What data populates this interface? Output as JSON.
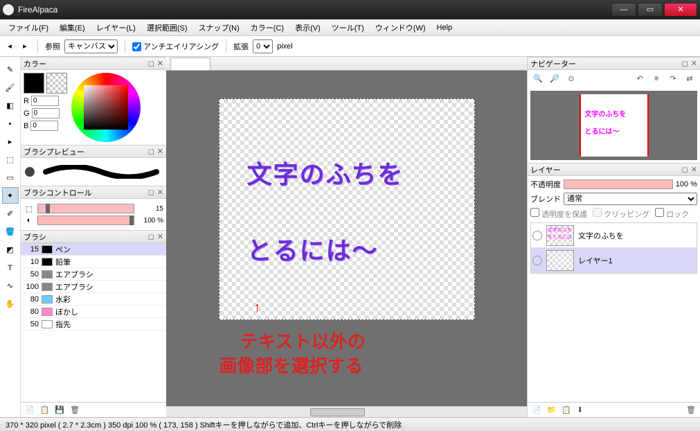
{
  "window": {
    "title": "FireAlpaca"
  },
  "menu": [
    "ファイル(F)",
    "編集(E)",
    "レイヤー(L)",
    "選択範囲(S)",
    "スナップ(N)",
    "カラー(C)",
    "表示(V)",
    "ツール(T)",
    "ウィンドウ(W)",
    "Help"
  ],
  "toolbar": {
    "ref_label": "参照",
    "ref_value": "キャンバス",
    "antialias": "アンチエイリアシング",
    "antialias_checked": true,
    "expand_label": "拡張",
    "expand_value": "0",
    "expand_unit": "pixel"
  },
  "left_tools": [
    "pen",
    "brush",
    "eraser",
    "dot",
    "move",
    "select",
    "rect-select",
    "wand",
    "eyedrop",
    "bucket",
    "gradient",
    "text",
    "lasso",
    "hand"
  ],
  "color": {
    "title": "カラー",
    "r_label": "R",
    "r_value": "0",
    "g_label": "G",
    "g_value": "0",
    "b_label": "B",
    "b_value": "0"
  },
  "brush_preview": {
    "title": "ブラシプレビュー"
  },
  "brush_control": {
    "title": "ブラシコントロール",
    "size_value": "15",
    "opacity_value": "100 %"
  },
  "brush_list": {
    "title": "ブラシ",
    "items": [
      {
        "size": "15",
        "name": "ペン",
        "color": "#000",
        "sel": true
      },
      {
        "size": "10",
        "name": "鉛筆",
        "color": "#000"
      },
      {
        "size": "50",
        "name": "エアブラシ",
        "color": "#888"
      },
      {
        "size": "100",
        "name": "エアブラシ",
        "color": "#888"
      },
      {
        "size": "80",
        "name": "水彩",
        "color": "#6cf"
      },
      {
        "size": "80",
        "name": "ぼかし",
        "color": "#f8c"
      },
      {
        "size": "50",
        "name": "指先",
        "color": "#fff"
      }
    ]
  },
  "tab_title": "",
  "canvas": {
    "line1": "文字のふちを",
    "line2": "とるには〜",
    "arrow": "↑",
    "note1": "テキスト以外の",
    "note2": "画像部を選択する"
  },
  "navigator": {
    "title": "ナビゲーター",
    "mini_line1": "文字のふちを",
    "mini_line2": "とるには〜"
  },
  "layers": {
    "title": "レイヤー",
    "opacity_label": "不透明度",
    "opacity_value": "100 %",
    "blend_label": "ブレンド",
    "blend_value": "通常",
    "protect_alpha": "透明度を保護",
    "clipping": "クリッピング",
    "lock": "ロック",
    "items": [
      {
        "name": "文字のふちを",
        "sel": false
      },
      {
        "name": "レイヤー1",
        "sel": true
      }
    ]
  },
  "status": "370 * 320 pixel   ( 2.7 * 2.3cm )   350 dpi   100 %   ( 173, 158 )   Shiftキーを押しながらで追加、Ctrlキーを押しながらで削除"
}
